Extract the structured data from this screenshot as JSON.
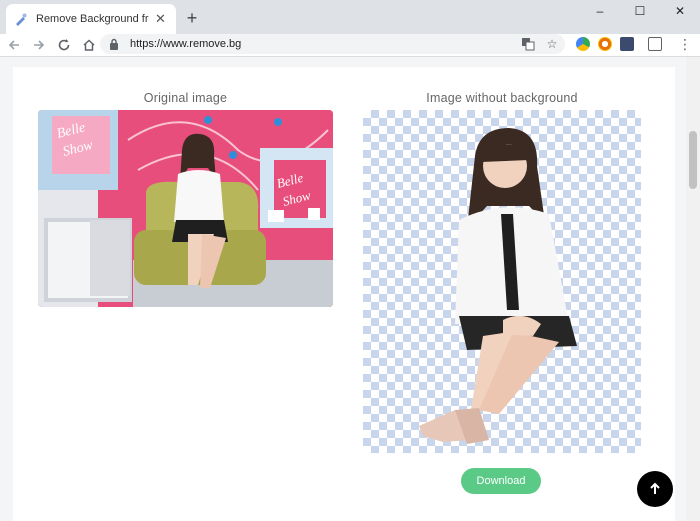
{
  "browser": {
    "tab_title": "Remove Background from Ima",
    "new_tab_symbol": "+",
    "url": "https://www.remove.bg",
    "window_controls": {
      "minimize": "–",
      "maximize": "☐",
      "close": "✕"
    }
  },
  "page": {
    "original_label": "Original image",
    "result_label": "Image without background",
    "download_label": "Download",
    "sign_text_1": "Belle",
    "sign_text_2": "Show"
  },
  "colors": {
    "accent_green": "#5cca87",
    "checker_blue": "#c9d5ea",
    "backdrop_pink": "#e84e7c"
  }
}
